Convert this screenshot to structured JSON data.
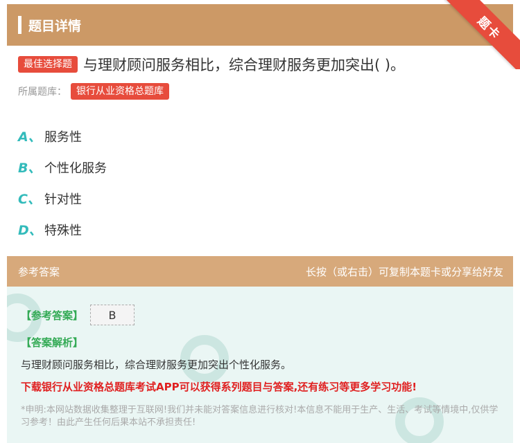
{
  "header": {
    "title": "题目详情"
  },
  "ribbon": {
    "label": "题卡"
  },
  "question": {
    "type_tag": "最佳选择题",
    "text": "与理财顾问服务相比，综合理财服务更加突出( )。",
    "bank_label": "所属题库：",
    "bank_name": "银行从业资格总题库"
  },
  "options": [
    {
      "letter": "A、",
      "text": "服务性"
    },
    {
      "letter": "B、",
      "text": "个性化服务"
    },
    {
      "letter": "C、",
      "text": "针对性"
    },
    {
      "letter": "D、",
      "text": "特殊性"
    }
  ],
  "answer_section": {
    "title": "参考答案",
    "hint": "长按（或右击）可复制本题卡或分享给好友",
    "answer_label": "【参考答案】",
    "answer_value": "B",
    "analysis_label": "【答案解析】",
    "analysis_text": "与理财顾问服务相比，综合理财服务更加突出个性化服务。",
    "promo": "下载银行从业资格总题库考试APP可以获得系列题目与答案,还有练习等更多学习功能!",
    "disclaimer": "*申明:本网站数据收集整理于互联网!我们并未能对答案信息进行核对!本信息不能用于生产、生活、考试等情境中,仅供学习参考！由此产生任何后果本站不承担责任!"
  },
  "colors": {
    "header_bg": "#cc9966",
    "ribbon": "#e74c3c",
    "option_letter": "#33bbbb",
    "answer_label": "#33aa55",
    "promo": "#e02020"
  }
}
